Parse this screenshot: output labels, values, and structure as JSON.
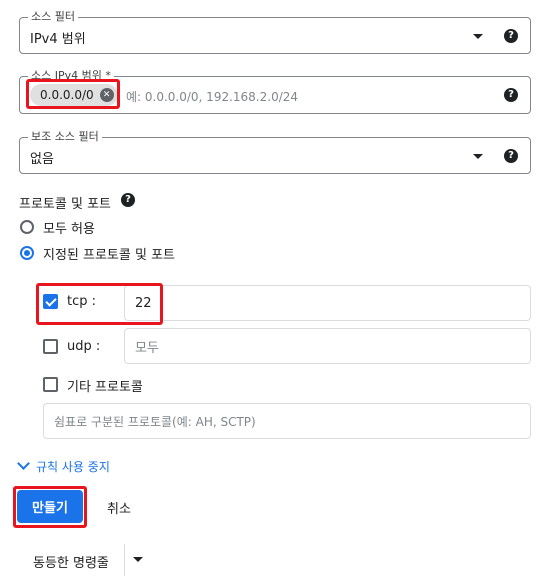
{
  "source_filter": {
    "label": "소스 필터",
    "value": "IPv4 범위",
    "help_icon": "?"
  },
  "source_ip_range": {
    "label": "소스 IPv4 범위 *",
    "chip": "0.0.0.0/0",
    "placeholder": "예: 0.0.0.0/0, 192.168.2.0/24",
    "help_icon": "?"
  },
  "secondary_filter": {
    "label": "보조 소스 필터",
    "value": "없음",
    "help_icon": "?"
  },
  "protocols": {
    "heading": "프로토콜 및 포트",
    "help_icon": "?",
    "options": [
      {
        "label": "모두 허용",
        "selected": false
      },
      {
        "label": "지정된 프로토콜 및 포트",
        "selected": true
      }
    ],
    "tcp": {
      "label": "tcp :",
      "checked": true,
      "value": "22"
    },
    "udp": {
      "label": "udp :",
      "checked": false,
      "placeholder": "모두"
    },
    "other": {
      "label": "기타 프로토콜",
      "checked": false,
      "placeholder": "쉼표로 구분된 프로토콜(예: AH, SCTP)"
    }
  },
  "disable_rule_link": "규칙 사용 중지",
  "create_button": "만들기",
  "cancel_button": "취소",
  "equivalent_command": "동등한 명령줄",
  "colors": {
    "accent": "#1a73e8",
    "highlight": "#e8141e"
  }
}
